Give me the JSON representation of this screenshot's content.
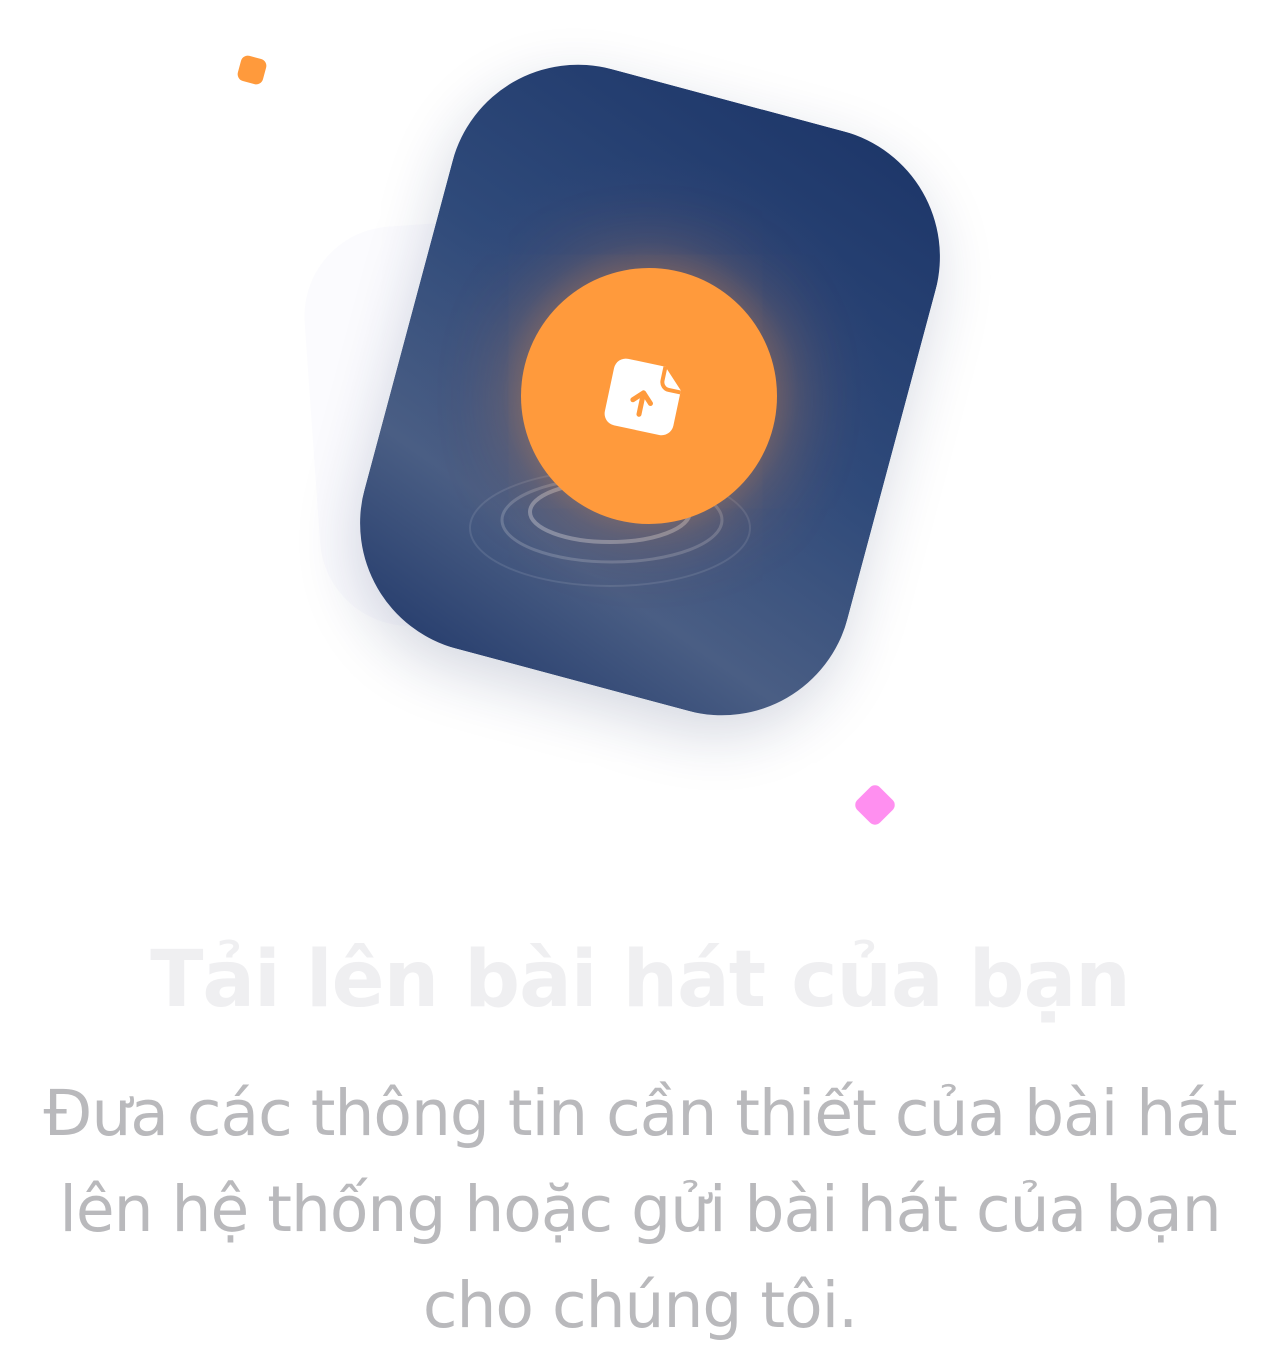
{
  "hero": {
    "title": "Tải lên bài hát của bạn",
    "description": "Đưa các thông tin cần thiết của bài hát lên hệ thống hoặc gửi bài hát của bạn cho chúng tôi."
  },
  "illustration": {
    "icon": "file-upload-icon",
    "colors": {
      "card_dark": "#1c3568",
      "card_mid": "#4a5e84",
      "accent_orange": "#ff9a3c",
      "accent_pink": "#ff8ff0",
      "title_text": "#efeff1",
      "description_text": "#b9b9bc"
    }
  }
}
